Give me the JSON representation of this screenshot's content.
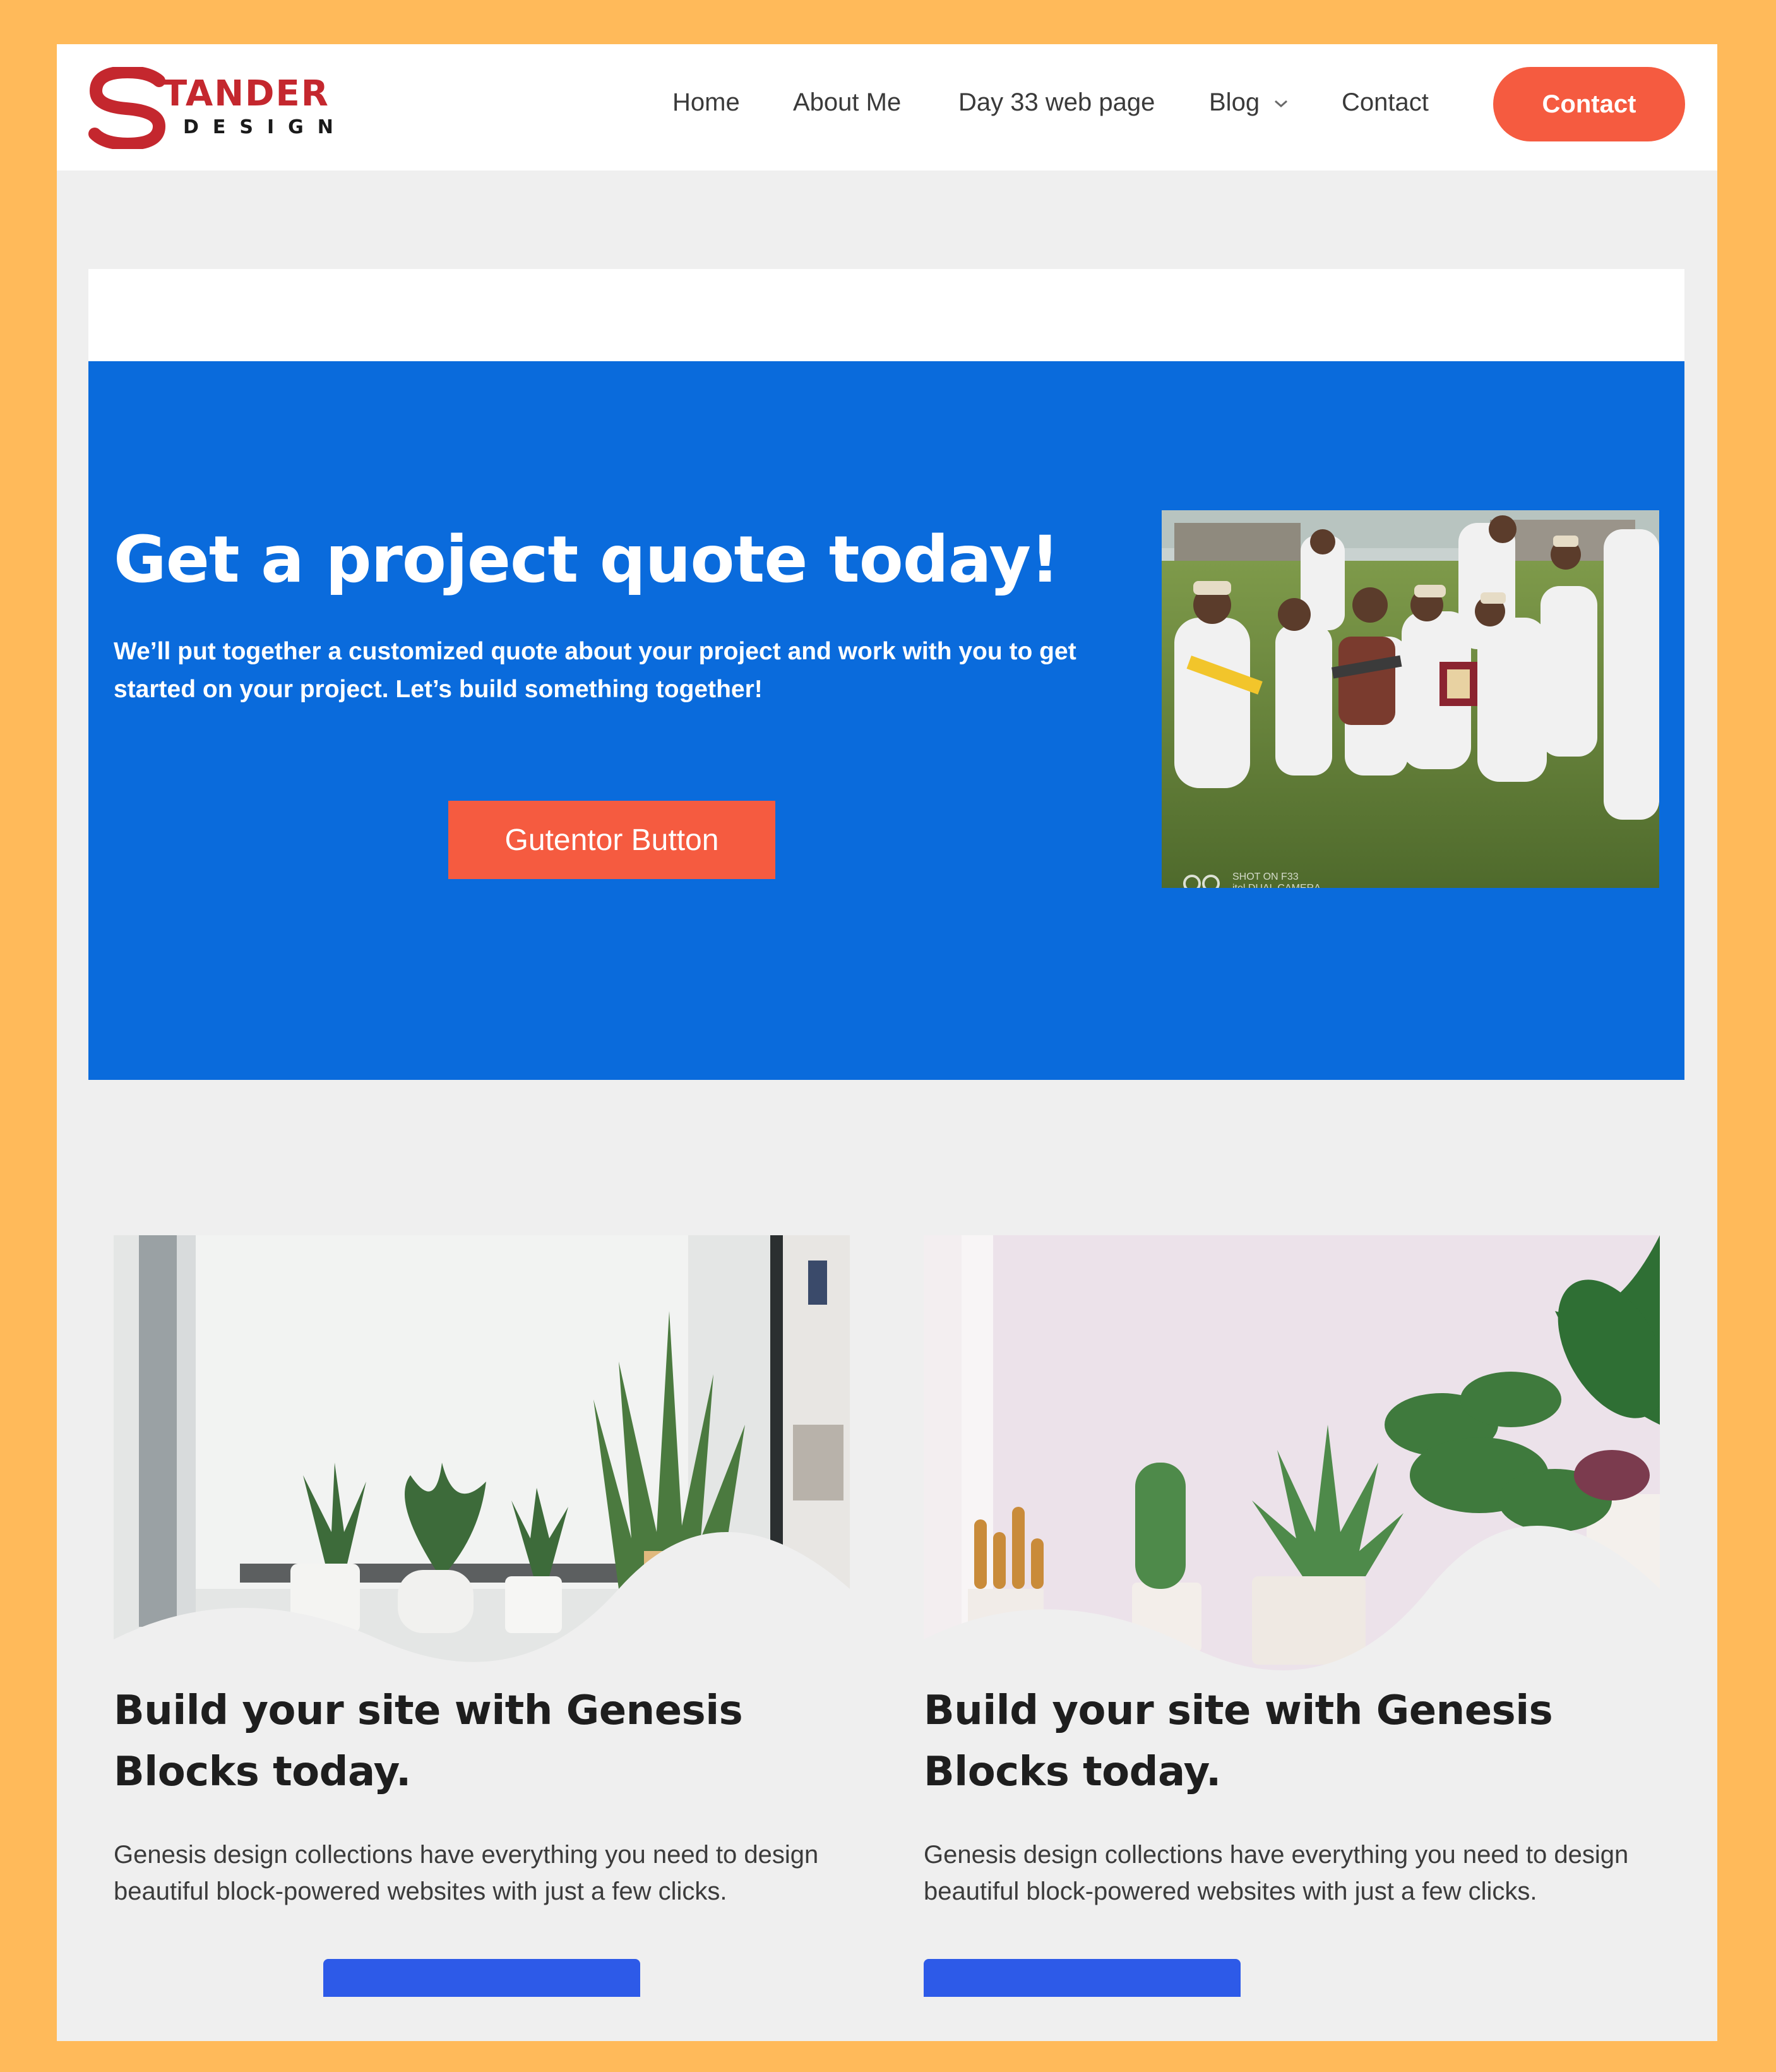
{
  "logo": {
    "word1": "TANDER",
    "word2": "DESIGN"
  },
  "nav": {
    "items": [
      "Home",
      "About Me",
      "Day 33 web page",
      "Blog",
      "Contact"
    ],
    "contact_button": "Contact"
  },
  "hero": {
    "title": "Get a project quote today!",
    "text": "We’ll put together a customized quote about your project and work with you to get started on your project. Let’s build something together!",
    "button": "Gutentor Button",
    "photo_caption_line1": "SHOT ON F33",
    "photo_caption_line2": "itel DUAL CAMERA"
  },
  "cards": [
    {
      "title": "Build your site with Genesis Blocks today.",
      "text": "Genesis design collections have everything you need to design beautiful block-powered websites with just a few clicks."
    },
    {
      "title": "Build your site with Genesis Blocks today.",
      "text": "Genesis design collections have everything you need to design beautiful block-powered websites with just a few clicks."
    }
  ],
  "colors": {
    "frame": "#ffba5a",
    "accent": "#f55b40",
    "hero_bg": "#0a6bdc",
    "card_button": "#2d5ae8"
  }
}
